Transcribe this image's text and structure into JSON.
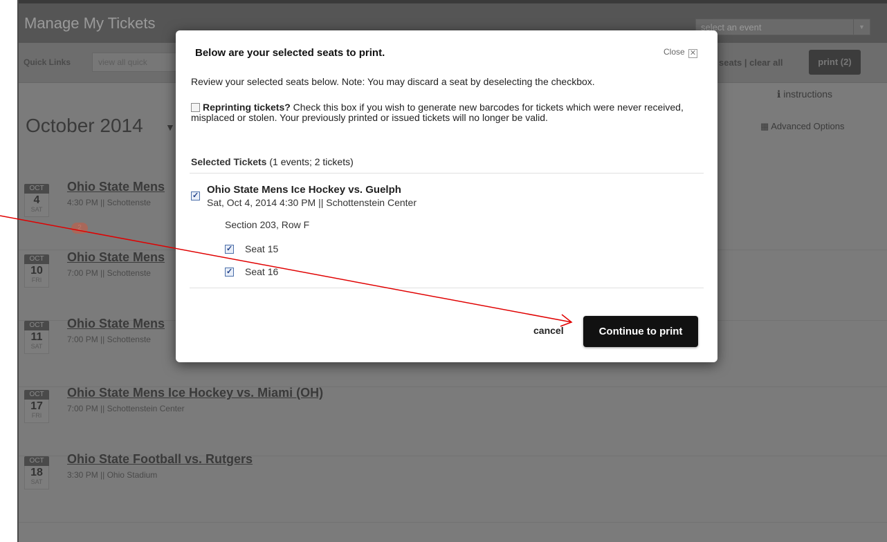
{
  "header": {
    "title": "Manage My Tickets",
    "event_select_value": "select an event"
  },
  "quicklinks": {
    "label": "Quick Links",
    "input_value": "view all quick",
    "seats_links": "seats | clear all",
    "print_label": "print (2)"
  },
  "tools": {
    "instructions_label": "instructions",
    "advanced_label": "Advanced Options"
  },
  "calendar": {
    "month": "October 2014"
  },
  "events": [
    {
      "mon": "OCT",
      "day": "4",
      "dow": "SAT",
      "title": "Ohio State Mens",
      "subtitle": "4:30 PM || Schottenste",
      "badge": "2"
    },
    {
      "mon": "OCT",
      "day": "10",
      "dow": "FRI",
      "title": "Ohio State Mens",
      "subtitle": "7:00 PM || Schottenste"
    },
    {
      "mon": "OCT",
      "day": "11",
      "dow": "SAT",
      "title": "Ohio State Mens",
      "subtitle": "7:00 PM || Schottenste"
    },
    {
      "mon": "OCT",
      "day": "17",
      "dow": "FRI",
      "title": "Ohio State Mens Ice Hockey vs. Miami (OH)",
      "subtitle": "7:00 PM || Schottenstein Center"
    },
    {
      "mon": "OCT",
      "day": "18",
      "dow": "SAT",
      "title": "Ohio State Football vs. Rutgers",
      "subtitle": "3:30 PM || Ohio Stadium"
    }
  ],
  "modal": {
    "heading": "Below are your selected seats to print.",
    "close_label": "Close",
    "note": "Review your selected seats below. Note: You may discard a seat by deselecting the checkbox.",
    "reprint_bold": "Reprinting tickets?",
    "reprint_text": " Check this box if you wish to generate new barcodes for tickets which were never received, misplaced or stolen. Your previously printed or issued tickets will no longer be valid.",
    "reprint_checked": false,
    "selected_bold": "Selected Tickets",
    "selected_count": " (1 events; 2 tickets)",
    "ticket": {
      "title": "Ohio State Mens Ice Hockey vs. Guelph",
      "subtitle": "Sat, Oct 4, 2014 4:30 PM || Schottenstein Center",
      "section": "Section 203, Row F",
      "seats": [
        "Seat 15",
        "Seat 16"
      ],
      "checked": true
    },
    "cancel_label": "cancel",
    "continue_label": "Continue to print"
  },
  "colors": {
    "annotation_arrow": "#e00000",
    "continue_button": "#111111"
  }
}
